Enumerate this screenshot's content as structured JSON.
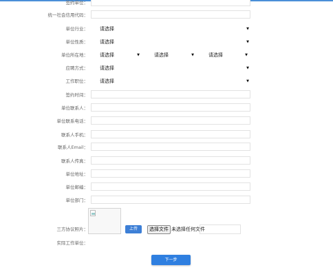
{
  "form": {
    "signing_unit": {
      "label": "签约单位：",
      "value": ""
    },
    "credit_code": {
      "label": "统一社会信用代码：",
      "value": ""
    },
    "industry": {
      "label": "单位行业：",
      "selected": "请选择"
    },
    "nature": {
      "label": "单位性质：",
      "selected": "请选择"
    },
    "location": {
      "label": "单位所在地：",
      "province": "请选择",
      "city": "请选择",
      "district": "请选择"
    },
    "employment_type": {
      "label": "应聘方式：",
      "selected": "请选择"
    },
    "position": {
      "label": "工作职位：",
      "selected": "请选择"
    },
    "sign_date": {
      "label": "签约时间：",
      "value": ""
    },
    "contact": {
      "label": "单位联系人：",
      "value": ""
    },
    "phone": {
      "label": "单位联系电话：",
      "value": ""
    },
    "mobile": {
      "label": "联系人手机：",
      "value": ""
    },
    "email": {
      "label": "联系人Email：",
      "value": ""
    },
    "fax": {
      "label": "联系人传真：",
      "value": ""
    },
    "address": {
      "label": "单位地址：",
      "value": ""
    },
    "postal_code": {
      "label": "单位邮编：",
      "value": ""
    },
    "department": {
      "label": "单位部门：",
      "value": ""
    },
    "agreement_photo": {
      "label": "三方协议照片：",
      "upload_label": "上传",
      "choose_file_label": "选择文件",
      "no_file_text": "未选择任何文件"
    },
    "actual_unit": {
      "label": "实际工作单位："
    }
  },
  "actions": {
    "next_label": "下一步"
  },
  "colors": {
    "accent": "#2f7fe0",
    "topbar": "#4a8fd8"
  },
  "icons": {
    "select_arrow": "chevron-down-icon",
    "image_placeholder": "broken-image-icon"
  }
}
